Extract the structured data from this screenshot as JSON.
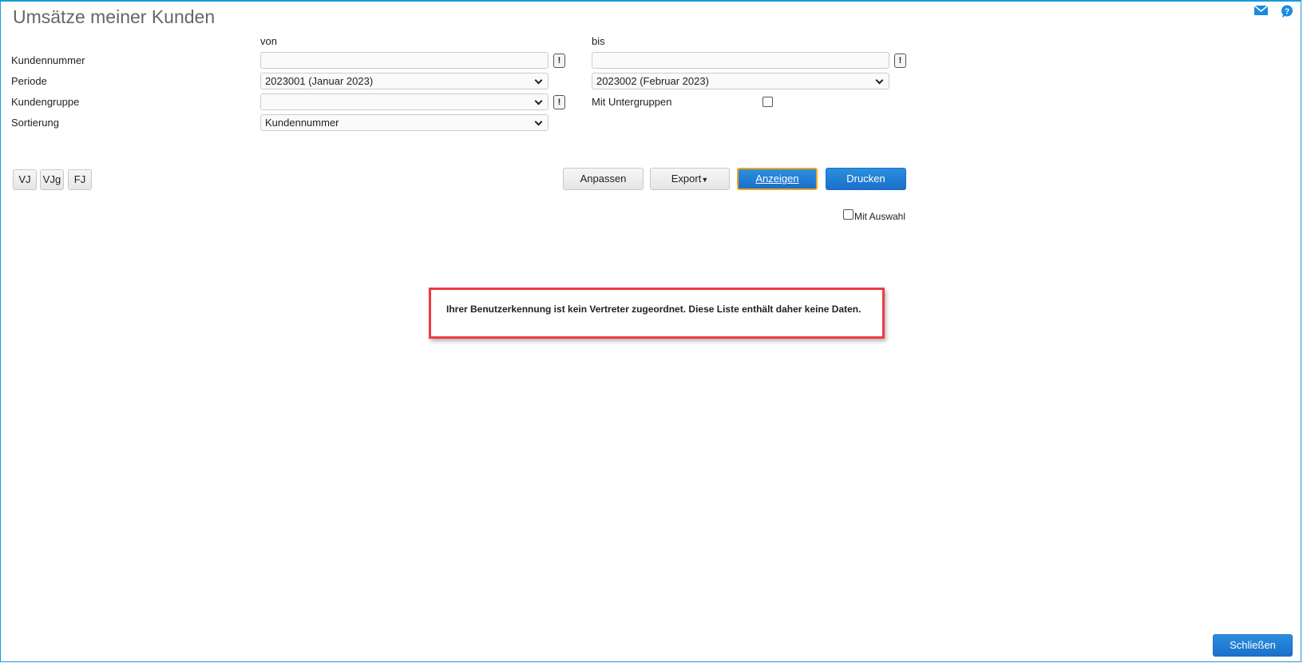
{
  "title": "Umsätze meiner Kunden",
  "icons": {
    "mail": "mail-icon",
    "help": "help-icon"
  },
  "columns": {
    "from": "von",
    "to": "bis"
  },
  "form": {
    "customer_number": {
      "label": "Kundennummer",
      "from_value": "",
      "to_value": "",
      "lookup": "!"
    },
    "period": {
      "label": "Periode",
      "from_value": "2023001 (Januar 2023)",
      "to_value": "2023002 (Februar 2023)"
    },
    "customer_group": {
      "label": "Kundengruppe",
      "value": "",
      "lookup": "!",
      "subgroups_label": "Mit Untergruppen",
      "subgroups_checked": false
    },
    "sorting": {
      "label": "Sortierung",
      "value": "Kundennummer"
    }
  },
  "quick_buttons": [
    "VJ",
    "VJg",
    "FJ"
  ],
  "actions": {
    "adjust": "Anpassen",
    "export": "Export",
    "show": "Anzeigen",
    "print": "Drucken"
  },
  "with_selection": {
    "label": "Mit Auswahl",
    "checked": false
  },
  "message": "Ihrer Benutzerkennung ist kein Vertreter zugeordnet. Diese Liste enthält daher keine Daten.",
  "close": "Schließen",
  "colors": {
    "accent": "#1b6fcb",
    "border": "#1a9ad6",
    "highlight": "#ee3b44",
    "focus": "#f5a623"
  }
}
